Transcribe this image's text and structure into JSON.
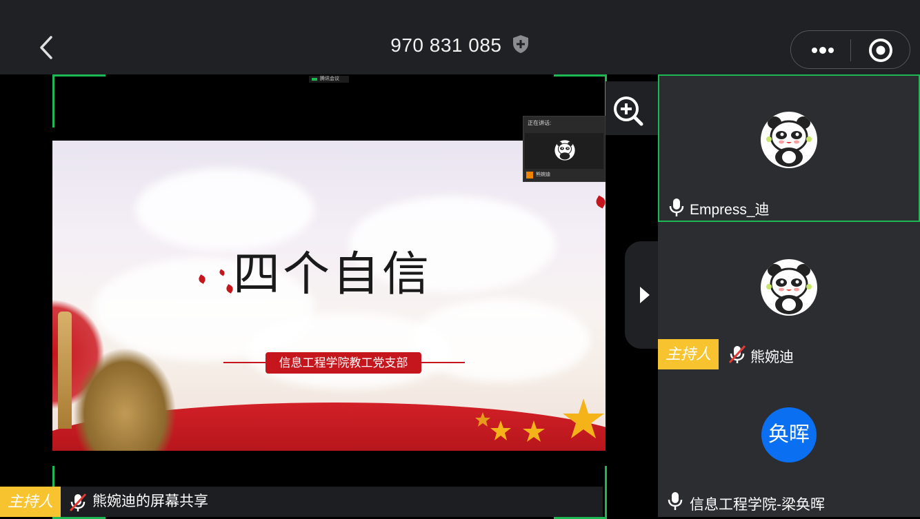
{
  "header": {
    "meeting_id": "970 831 085",
    "icons": {
      "back": "chevron-left-icon",
      "secure": "shield-plus-icon",
      "more": "more-dots-icon",
      "record": "record-icon"
    }
  },
  "shared_screen": {
    "app_status": "腾讯会议",
    "slide": {
      "title": "四个自信",
      "subtitle": "信息工程学院教工党支部"
    },
    "speaker_pip": {
      "label": "正在讲话:",
      "name": "熊婉迪"
    },
    "bottom_bar": {
      "host_badge": "主持人",
      "label": "熊婉迪的屏幕共享",
      "mic_state": "muted"
    }
  },
  "participants": [
    {
      "name": "Empress_迪",
      "avatar": "panda",
      "mic_state": "on",
      "active": true
    },
    {
      "name": "熊婉迪",
      "avatar": "panda",
      "mic_state": "muted",
      "host_badge": "主持人"
    },
    {
      "name": "信息工程学院-梁奂晖",
      "avatar_text": "奂晖",
      "mic_state": "on"
    }
  ],
  "colors": {
    "accent_green": "#1db954",
    "host_yellow": "#f7c32e",
    "mute_red": "#e53935",
    "avatar_blue": "#0b6ff2",
    "slide_red": "#c4161c"
  }
}
